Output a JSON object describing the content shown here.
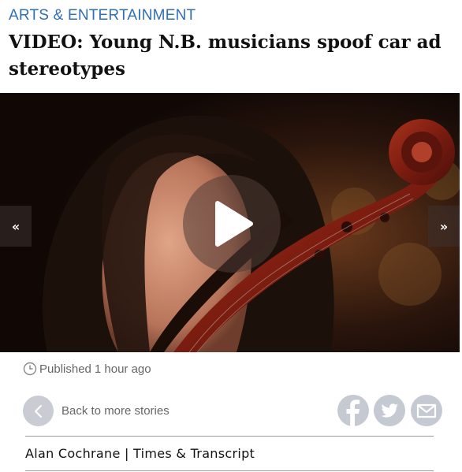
{
  "article": {
    "category": "ARTS & ENTERTAINMENT",
    "headline": "VIDEO: Young N.B. musicians spoof car ad stereotypes"
  },
  "media": {
    "prev_label": "«",
    "next_label": "»",
    "play_icon": "play-icon"
  },
  "meta": {
    "published_label": "Published",
    "published_time": "1 hour ago",
    "clock_icon": "clock-icon"
  },
  "navigation": {
    "back_label": "Back to more stories"
  },
  "share": {
    "icons": [
      "facebook-icon",
      "twitter-icon",
      "email-icon"
    ],
    "icon_color": "#c4c9d2"
  },
  "byline": {
    "text": "Alan Cochrane | Times & Transcript"
  },
  "colors": {
    "category": "#2f6fb7",
    "headline": "#111111",
    "muted_text": "#666666"
  }
}
